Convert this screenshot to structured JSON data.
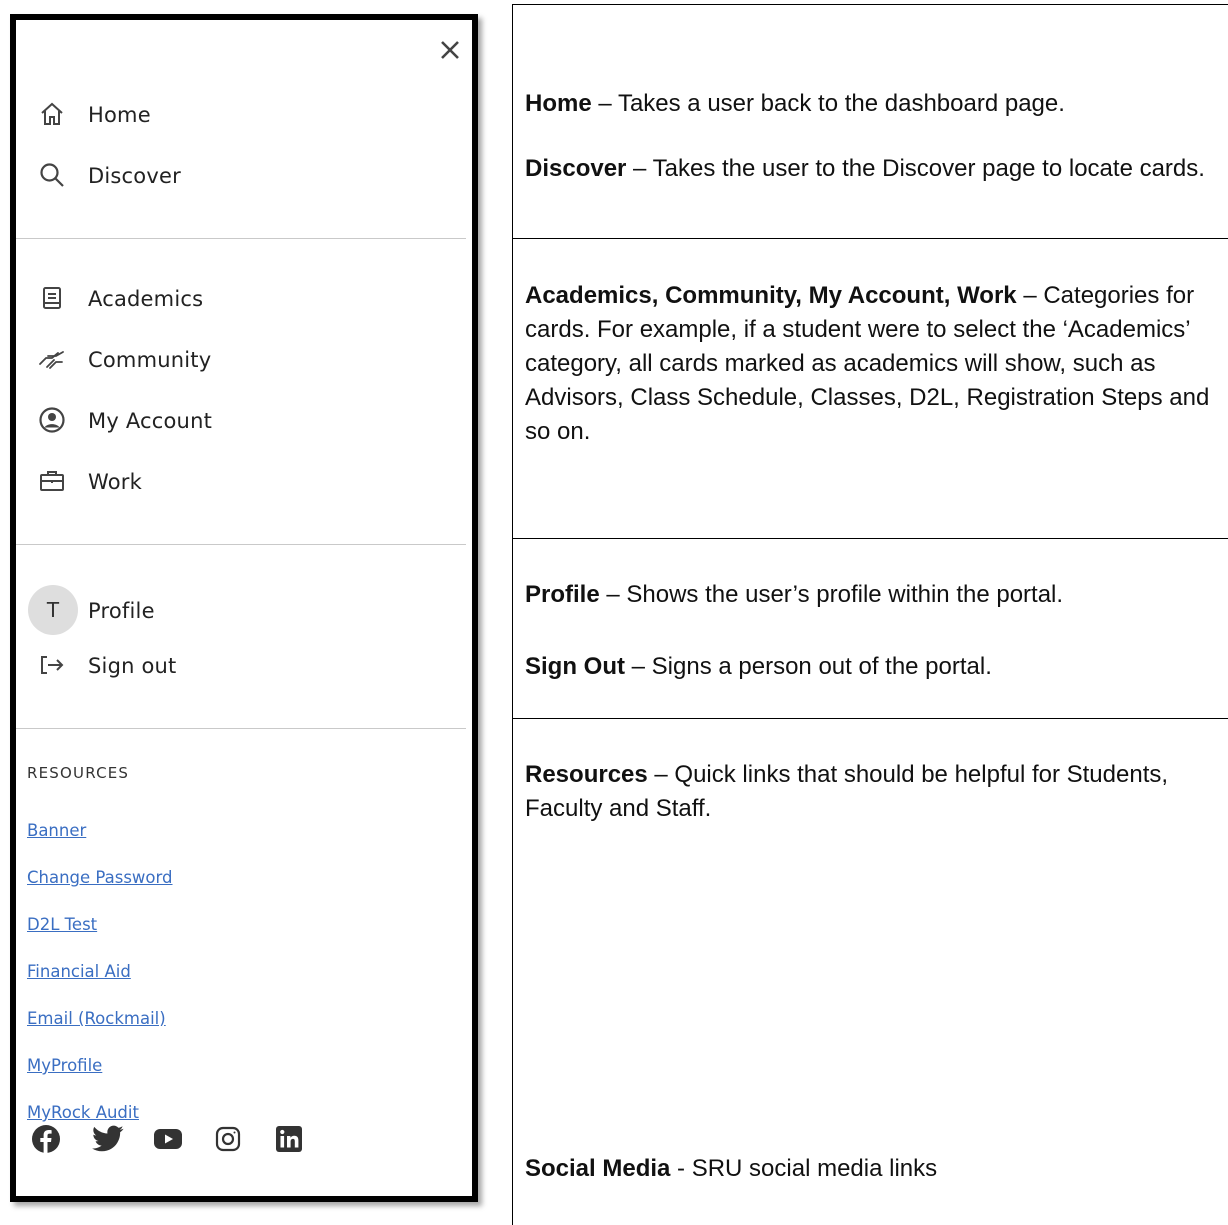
{
  "drawer": {
    "close_label": "Close",
    "nav_primary": [
      {
        "label": "Home",
        "icon": "home-icon"
      },
      {
        "label": "Discover",
        "icon": "search-icon"
      }
    ],
    "categories": [
      {
        "label": "Academics",
        "icon": "book-icon"
      },
      {
        "label": "Community",
        "icon": "handshake-icon"
      },
      {
        "label": "My Account",
        "icon": "account-circle-icon"
      },
      {
        "label": "Work",
        "icon": "briefcase-icon"
      }
    ],
    "profile": {
      "avatar_initial": "T",
      "label": "Profile"
    },
    "sign_out": {
      "label": "Sign out",
      "icon": "sign-out-icon"
    },
    "resources": {
      "title": "RESOURCES",
      "links": [
        "Banner",
        "Change Password",
        "D2L Test",
        "Financial Aid",
        "Email (Rockmail)",
        "MyProfile",
        "MyRock Audit"
      ]
    },
    "social_icons": [
      "facebook-icon",
      "twitter-icon",
      "youtube-icon",
      "instagram-icon",
      "linkedin-icon"
    ],
    "link_color": "#3a6ec2"
  },
  "descriptions": {
    "home": {
      "term": "Home",
      "text": " – Takes a user back to the dashboard page."
    },
    "discover": {
      "term": "Discover",
      "text": " – Takes the user to the Discover page to locate cards."
    },
    "categories": {
      "term": "Academics, Community, My Account, Work",
      "text": " – Categories for cards.  For example, if a student were to select the ‘Academics’ category, all cards marked as academics will show, such as Advisors, Class Schedule, Classes, D2L, Registration Steps and so on."
    },
    "profile": {
      "term": "Profile",
      "text": " – Shows the user’s profile within the portal."
    },
    "sign_out": {
      "term": "Sign Out",
      "text": " – Signs a person out of the portal."
    },
    "resources": {
      "term": "Resources",
      "text": " – Quick links that should be helpful for Students, Faculty and Staff."
    },
    "social": {
      "term": "Social Media",
      "text": " - SRU social media links"
    }
  }
}
